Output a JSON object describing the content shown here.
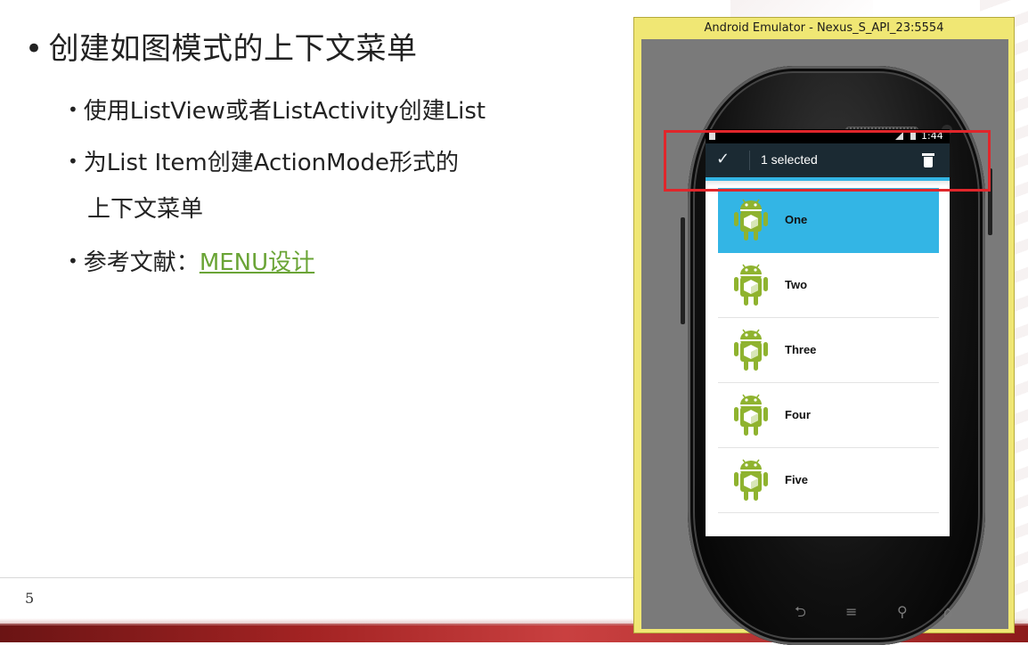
{
  "slide": {
    "bullets": {
      "main": "创建如图模式的上下文菜单",
      "sub1": "使用ListView或者ListActivity创建List",
      "sub2_line1": "为List  Item创建ActionMode形式的",
      "sub2_line2": "上下文菜单",
      "sub3_prefix": "参考文献：",
      "sub3_link": "MENU设计"
    },
    "page_number": "5",
    "bullet_glyph": "•"
  },
  "emulator": {
    "title": "Android Emulator - Nexus_S_API_23:5554"
  },
  "device": {
    "status_time": "1:44",
    "action_mode": {
      "title": "1 selected",
      "done_icon": "✓"
    },
    "list_items": [
      {
        "label": "One",
        "selected": true
      },
      {
        "label": "Two",
        "selected": false
      },
      {
        "label": "Three",
        "selected": false
      },
      {
        "label": "Four",
        "selected": false
      },
      {
        "label": "Five",
        "selected": false
      }
    ],
    "nav": {
      "back": "⮌",
      "menu": "≡",
      "search": "⚲",
      "home": "⌂"
    }
  },
  "colors": {
    "action_bar": "#1b2a33",
    "selected_row": "#33b5e5",
    "highlight_box": "#e0262b",
    "link": "#6aa436",
    "emulator_frame": "#f0e774"
  }
}
